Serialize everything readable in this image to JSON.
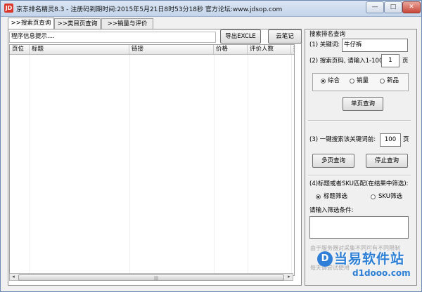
{
  "window": {
    "icon_text": "JD",
    "title": "京东排名精灵8.3 - 注册码到期时间:2015年5月21日8时53分18秒    官方论坛:www.jdsop.com",
    "controls": {
      "minimize": "—",
      "maximize": "□",
      "close": "✕"
    }
  },
  "tabs": [
    {
      "label": ">>搜索页查询",
      "active": true
    },
    {
      "label": ">>类目页查询",
      "active": false
    },
    {
      "label": ">>销量与评价",
      "active": false
    }
  ],
  "toolbar": {
    "info_label": "程序信息提示....",
    "export_button": "导出EXCLE",
    "cloud_note_button": "云笔记"
  },
  "table": {
    "columns": [
      "页位",
      "标题",
      "链接",
      "价格",
      "评价人数",
      "数"
    ]
  },
  "scrollbar": {
    "left_arrow": "◂",
    "right_arrow": "▸",
    "grip": "|||"
  },
  "search_panel": {
    "title": "搜索排名查询",
    "keyword_label": "(1) 关键词:",
    "keyword_value": "牛仔裤",
    "page_label": "(2) 搜索页码, 请输入1-100:",
    "page_value": "1",
    "page_unit": "页",
    "sort_options": [
      {
        "label": "综合",
        "selected": true
      },
      {
        "label": "销量",
        "selected": false
      },
      {
        "label": "新品",
        "selected": false
      }
    ],
    "single_query_button": "单页查询",
    "batch_label": "(3) 一键搜索该关键词前:",
    "batch_value": "100",
    "batch_unit": "页",
    "multi_query_button": "多页查询",
    "stop_query_button": "停止查询",
    "filter_title": "(4)标题或者SKU匹配(在结果中筛选):",
    "filter_options": [
      {
        "label": "标题筛选",
        "selected": true
      },
      {
        "label": "SKU筛选",
        "selected": false
      }
    ],
    "filter_input_label": "请输入筛选条件:",
    "filter_value": ""
  },
  "watermark": {
    "line1": "由于服务器对采集不同可有不同限制",
    "line2": "每天请尝试使用",
    "logo_letter": "D",
    "brand": "当易软件站",
    "url": "d1dooo.com"
  }
}
